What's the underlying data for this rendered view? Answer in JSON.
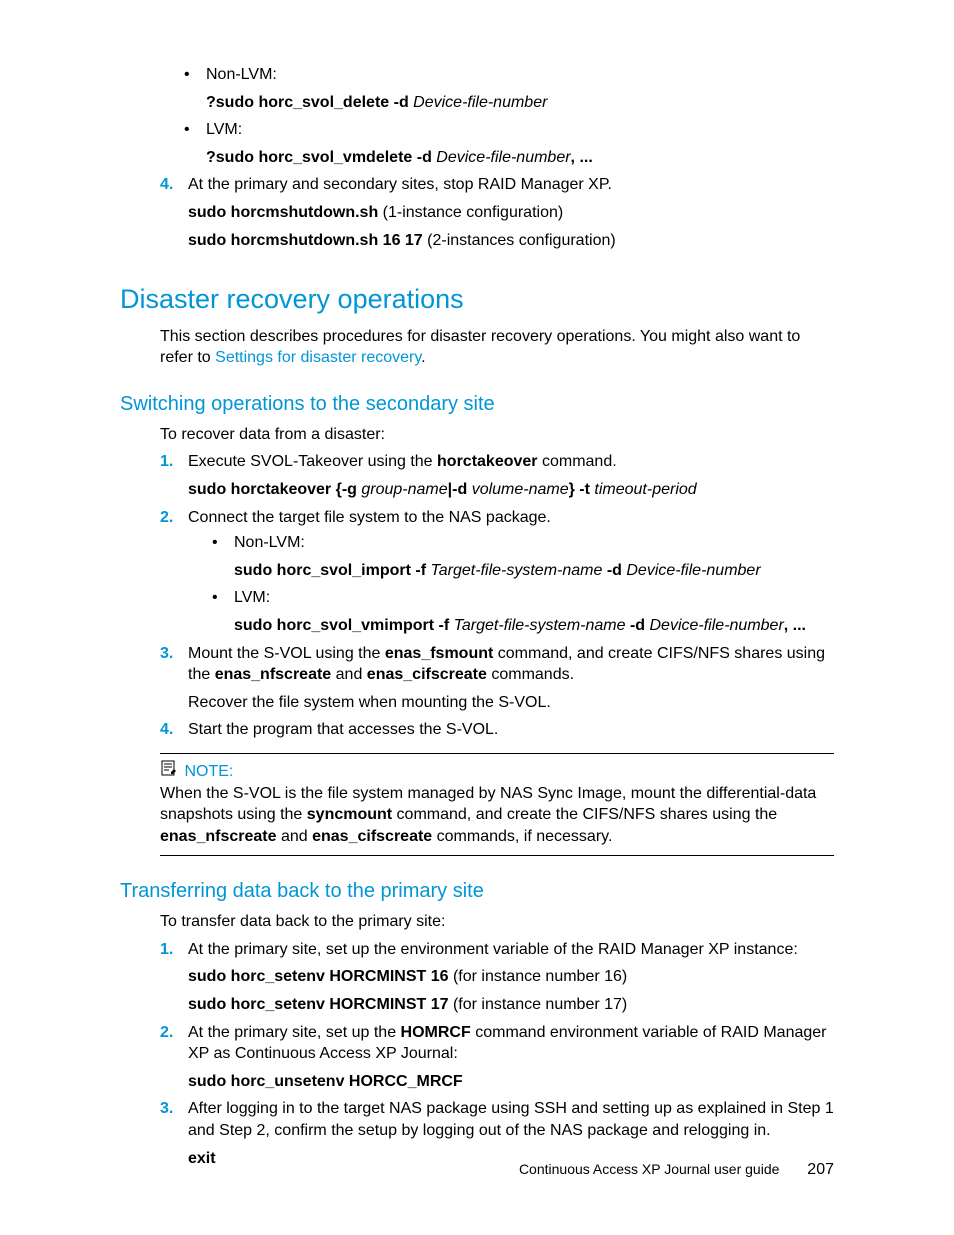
{
  "topList": {
    "bullets": [
      {
        "label": "Non-LVM:",
        "cmd_bold": "?sudo horc_svol_delete -d ",
        "cmd_italic": "Device-file-number",
        "trail": ""
      },
      {
        "label": "LVM:",
        "cmd_bold": "?sudo horc_svol_vmdelete -d ",
        "cmd_italic": "Device-file-number",
        "trail": ", ..."
      }
    ],
    "step4": {
      "num": "4.",
      "text": "At the primary and secondary sites, stop RAID Manager XP.",
      "cmd1_bold": "sudo horcmshutdown.sh",
      "cmd1_rest": " (1-instance configuration)",
      "cmd2_bold": "sudo horcmshutdown.sh 16 17",
      "cmd2_rest": " (2-instances configuration)"
    }
  },
  "sec1": {
    "title": "Disaster recovery operations",
    "intro_a": "This section describes procedures for disaster recovery operations.  You might also want to refer to ",
    "intro_link": "Settings for disaster recovery",
    "intro_b": "."
  },
  "sub1": {
    "title": "Switching operations to the secondary site",
    "intro": "To recover data from a disaster:",
    "s1": {
      "num": "1.",
      "pre": "Execute SVOL-Takeover using the ",
      "bold": "horctakeover",
      "post": " command.",
      "cmd_b1": "sudo horctakeover {-g ",
      "cmd_i1": "group-name",
      "cmd_b2": "|-d ",
      "cmd_i2": "volume-name",
      "cmd_b3": "} -t ",
      "cmd_i3": "timeout-period"
    },
    "s2": {
      "num": "2.",
      "text": "Connect the target file system to the NAS package.",
      "b1_label": "Non-LVM:",
      "b1_cmd_b1": "sudo horc_svol_import -f ",
      "b1_cmd_i1": "Target-file-system-name",
      "b1_cmd_b2": " -d ",
      "b1_cmd_i2": "Device-file-number",
      "b2_label": "LVM:",
      "b2_cmd_b1": "sudo horc_svol_vmimport -f ",
      "b2_cmd_i1": "Target-file-system-name",
      "b2_cmd_b2": " -d ",
      "b2_cmd_i2": "Device-file-number",
      "b2_trail": ", ..."
    },
    "s3": {
      "num": "3.",
      "pre": "Mount the S-VOL using the ",
      "b1": "enas_fsmount",
      "mid1": " command, and create CIFS/NFS shares using the ",
      "b2": "enas_nfscreate",
      "mid2": " and ",
      "b3": "enas_cifscreate",
      "post": " commands.",
      "extra": "Recover the file system when mounting the S-VOL."
    },
    "s4": {
      "num": "4.",
      "text": "Start the program that accesses the S-VOL."
    }
  },
  "note": {
    "head": "NOTE:",
    "pre": "When the S-VOL is the file system managed by NAS Sync Image, mount the differential-data snapshots using the ",
    "b1": "syncmount",
    "mid1": " command, and create the CIFS/NFS shares using the ",
    "b2": "enas_nfscreate",
    "mid2": " and ",
    "b3": "enas_cifscreate",
    "post": " commands, if necessary."
  },
  "sub2": {
    "title": "Transferring data back to the primary site",
    "intro": "To transfer data back to the primary site:",
    "s1": {
      "num": "1.",
      "text": "At the primary site, set up the environment variable of the RAID Manager XP instance:",
      "cmd1_b": "sudo horc_setenv HORCMINST 16",
      "cmd1_r": " (for instance number 16)",
      "cmd2_b": "sudo horc_setenv HORCMINST 17",
      "cmd2_r": " (for instance number 17)"
    },
    "s2": {
      "num": "2.",
      "pre": "At the primary site, set up the ",
      "b1": "HOMRCF",
      "post": " command environment variable of RAID Manager XP as Continuous Access XP Journal:",
      "cmd_b": "sudo horc_unsetenv HORCC_MRCF"
    },
    "s3": {
      "num": "3.",
      "text": "After logging in to the target NAS package using SSH and setting up as explained in Step 1 and Step 2, confirm the setup by logging out of the NAS package and relogging in.",
      "cmd_b": "exit"
    }
  },
  "footer": {
    "text": "Continuous Access XP Journal user guide",
    "page": "207"
  }
}
